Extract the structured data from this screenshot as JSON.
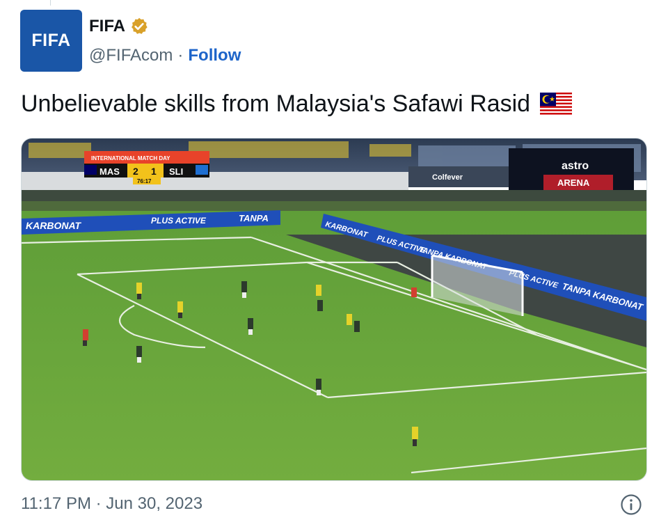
{
  "account": {
    "avatar_text": "FIFA",
    "name": "FIFA",
    "handle": "@FIFAcom",
    "separator": "·",
    "follow_label": "Follow",
    "verified_badge_color": "#d9a12a",
    "avatar_color": "#1a56a7"
  },
  "tweet": {
    "text": "Unbelievable skills from Malaysia's Safawi Rasid",
    "flag_icon": "malaysia-flag-icon",
    "timestamp": "11:17 PM · Jun 30, 2023"
  },
  "media": {
    "scoreboard": {
      "competition": "INTERNATIONAL MATCH DAY",
      "home": "MAS",
      "home_score": "2",
      "away_score": "1",
      "away": "SLI",
      "clock": "76:17"
    },
    "ads": {
      "left_board": "KARBONAT",
      "left_board_2": "PLUS ACTIVE",
      "left_board_3": "TANPA",
      "right_board_1": "KARBONAT",
      "right_board_2": "PLUS ACTIVE",
      "right_board_3": "TANPA KARBONAT",
      "right_board_4": "PLUS ACTIVE",
      "right_board_5": "TANPA KARBONAT",
      "stadium_sign": "Colfever",
      "astro": "astro",
      "arena": "ARENA"
    }
  }
}
